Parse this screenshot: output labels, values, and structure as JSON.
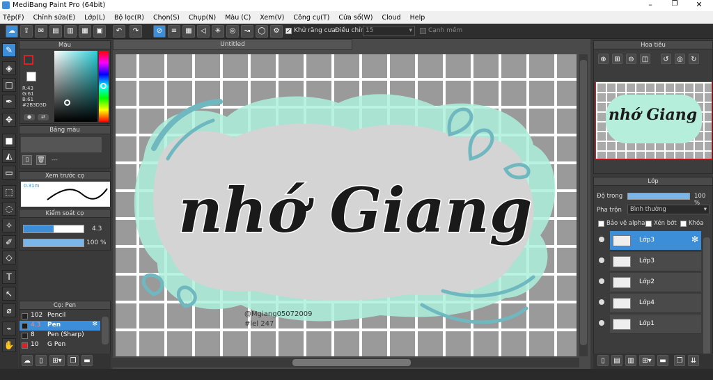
{
  "app": {
    "title": "MediBang Paint Pro (64bit)"
  },
  "menu": [
    "Tệp(F)",
    "Chỉnh sửa(E)",
    "Lớp(L)",
    "Bộ lọc(R)",
    "Chọn(S)",
    "Chụp(N)",
    "Màu (C)",
    "Xem(V)",
    "Công cụ(T)",
    "Cửa sổ(W)",
    "Cloud",
    "Help"
  ],
  "toolbar": {
    "antialias_label": "Khử răng cưa",
    "adjust_label": "Điều chỉnh",
    "adjust_value": "15",
    "smooth_label": "Cạnh mềm"
  },
  "color_panel": {
    "title": "Màu",
    "r": "R:43",
    "g": "G:61",
    "b": "B:61",
    "hex": "#2B3D3D"
  },
  "palette_panel": {
    "title": "Bảng màu",
    "placeholder": "---"
  },
  "brush_preview": {
    "title": "Xem trước cọ",
    "size": "0.31m"
  },
  "brush_control": {
    "title": "Kiểm soát cọ",
    "size": "4.3",
    "opacity": "100 %",
    "size_fraction": 0.5,
    "opacity_fraction": 1.0
  },
  "brush_list": {
    "title": "Cọ: Pen",
    "items": [
      {
        "num": "102",
        "name": "Pencil",
        "color": "#222222"
      },
      {
        "num": "4.3",
        "name": "Pen",
        "color": "#1a1a1a",
        "selected": true
      },
      {
        "num": "8",
        "name": "Pen (Sharp)",
        "color": "#222222"
      },
      {
        "num": "10",
        "name": "G Pen",
        "color": "#e02020"
      }
    ]
  },
  "canvas": {
    "tab": "Untitled",
    "text_main": "nhớ Giang",
    "signature1": "@Mgiang05072009",
    "signature2": "#lel 247"
  },
  "navigator": {
    "title": "Hoa tiêu",
    "preview_text": "nhớ Giang"
  },
  "layers": {
    "title": "Lớp",
    "opacity_label": "Độ trong",
    "opacity_value": "100 %",
    "opacity_fraction": 1.0,
    "blend_label": "Pha trộn",
    "blend_value": "Bình thường",
    "protect_alpha": "Bảo vệ alpha",
    "clip": "Xén bớt",
    "lock": "Khóa",
    "items": [
      "Lớp3",
      "Lớp3",
      "Lớp2",
      "Lớp4",
      "Lớp1"
    ]
  },
  "colors": {
    "accent": "#3d8ed8",
    "panel": "#3c3c3c",
    "grid_bg": "#9a9a9a",
    "mint": "#aef0dc",
    "teal": "#6fb8c0"
  }
}
